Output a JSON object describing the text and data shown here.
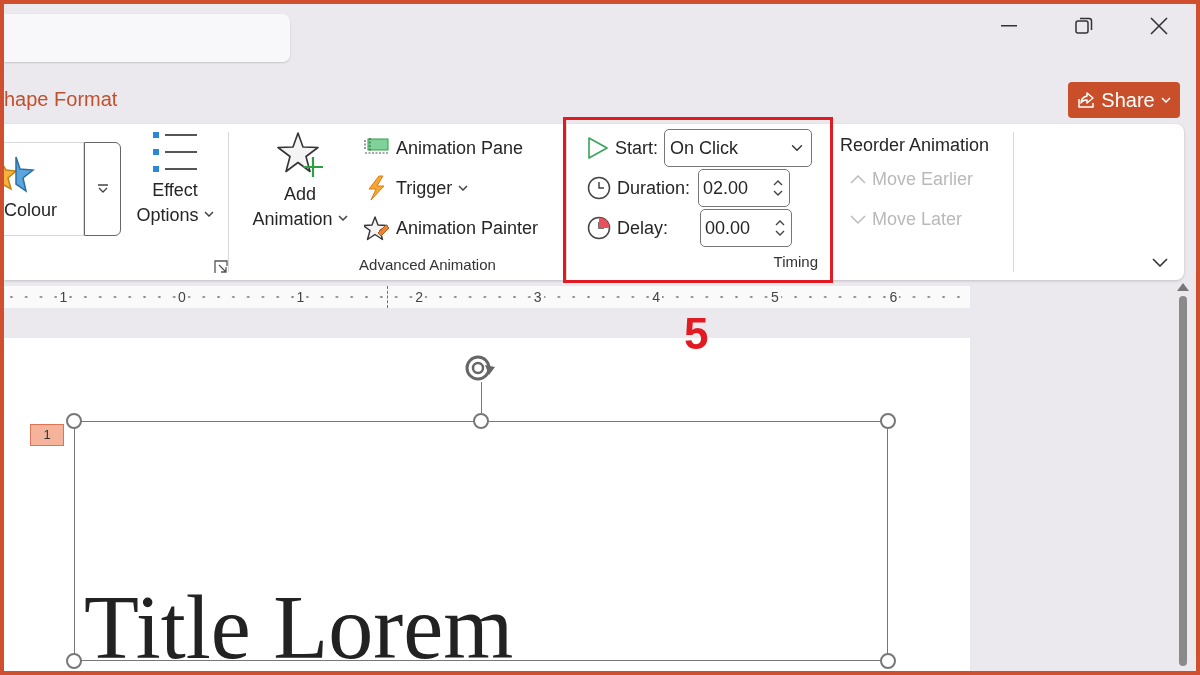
{
  "ribbon_tabs": [
    {
      "label": "hape Format",
      "selected": false
    }
  ],
  "share_button": {
    "label": "Share",
    "dropdown": true
  },
  "ribbon": {
    "animation_group": {
      "gallery_item": {
        "label": "Colour"
      },
      "effect_options": {
        "label": "Effect Options",
        "dropdown": true
      }
    },
    "advanced_animation": {
      "add_animation": {
        "label": "Add Animation",
        "dropdown": true
      },
      "commands": [
        {
          "kind": "pane",
          "label": "Animation Pane",
          "dropdown": false
        },
        {
          "kind": "trigger",
          "label": "Trigger",
          "dropdown": true
        },
        {
          "kind": "painter",
          "label": "Animation Painter",
          "dropdown": false
        }
      ],
      "group_label": "Advanced Animation"
    },
    "timing": {
      "highlighted": true,
      "start": {
        "label": "Start:",
        "value": "On Click"
      },
      "duration": {
        "label": "Duration:",
        "value": "02.00"
      },
      "delay": {
        "label": "Delay:",
        "value": "00.00"
      },
      "group_label": "Timing"
    },
    "reorder": {
      "title": "Reorder Animation",
      "commands": [
        {
          "kind": "earlier",
          "label": "Move Earlier",
          "disabled": true
        },
        {
          "kind": "later",
          "label": "Move Later",
          "disabled": true
        }
      ]
    }
  },
  "callout": {
    "label": "5"
  },
  "ruler": {
    "labels": [
      "1",
      "0",
      "1",
      "2",
      "3",
      "4",
      "5",
      "6"
    ]
  },
  "slide": {
    "animation_tags": [
      {
        "label": "1"
      }
    ],
    "title": "Title Lorem",
    "selected": true
  }
}
